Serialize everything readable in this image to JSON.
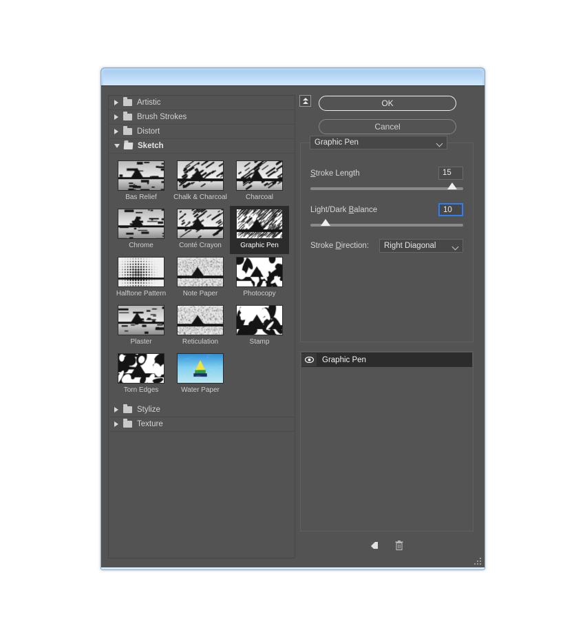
{
  "window": {
    "title": "",
    "frame_color": "#b7d7f5"
  },
  "dialog": {
    "background": "#535353",
    "accent": "#2d7ff9"
  },
  "filter_browser": {
    "categories": [
      {
        "label": "Artistic",
        "expanded": false,
        "icon": "folder-closed-icon",
        "triangle": "triangle-right-icon"
      },
      {
        "label": "Brush Strokes",
        "expanded": false,
        "icon": "folder-closed-icon",
        "triangle": "triangle-right-icon"
      },
      {
        "label": "Distort",
        "expanded": false,
        "icon": "folder-closed-icon",
        "triangle": "triangle-right-icon"
      },
      {
        "label": "Sketch",
        "expanded": true,
        "icon": "folder-open-icon",
        "triangle": "triangle-down-icon"
      }
    ],
    "trailing_categories": [
      {
        "label": "Stylize",
        "expanded": false,
        "icon": "folder-closed-icon",
        "triangle": "triangle-right-icon"
      },
      {
        "label": "Texture",
        "expanded": false,
        "icon": "folder-closed-icon",
        "triangle": "triangle-right-icon"
      }
    ],
    "thumbnails": [
      {
        "label": "Bas Relief",
        "selected": false
      },
      {
        "label": "Chalk & Charcoal",
        "selected": false
      },
      {
        "label": "Charcoal",
        "selected": false
      },
      {
        "label": "Chrome",
        "selected": false
      },
      {
        "label": "Conté Crayon",
        "selected": false
      },
      {
        "label": "Graphic Pen",
        "selected": true
      },
      {
        "label": "Halftone Pattern",
        "selected": false
      },
      {
        "label": "Note Paper",
        "selected": false
      },
      {
        "label": "Photocopy",
        "selected": false
      },
      {
        "label": "Plaster",
        "selected": false
      },
      {
        "label": "Reticulation",
        "selected": false
      },
      {
        "label": "Stamp",
        "selected": false
      },
      {
        "label": "Torn Edges",
        "selected": false
      },
      {
        "label": "Water Paper",
        "selected": false
      }
    ]
  },
  "controls": {
    "collapse_button_icon": "double-chevron-up-icon",
    "ok_label": "OK",
    "cancel_label": "Cancel"
  },
  "settings": {
    "filter_name": "Graphic Pen",
    "dropdown_icon": "chevron-down-icon",
    "stroke_length": {
      "label": "Stroke Length",
      "value": "15",
      "slider_percent": 93,
      "focused": false
    },
    "light_dark_balance": {
      "label": "Light/Dark Balance",
      "value": "10",
      "slider_percent": 10,
      "focused": true
    },
    "stroke_direction": {
      "label": "Stroke Direction:",
      "value": "Right Diagonal"
    }
  },
  "effect_layers": {
    "items": [
      {
        "name": "Graphic Pen",
        "visible": true,
        "visibility_icon": "eye-icon"
      }
    ],
    "new_layer_icon": "new-effect-layer-icon",
    "delete_layer_icon": "trash-icon"
  },
  "resize_grip": "resize-grip-icon"
}
